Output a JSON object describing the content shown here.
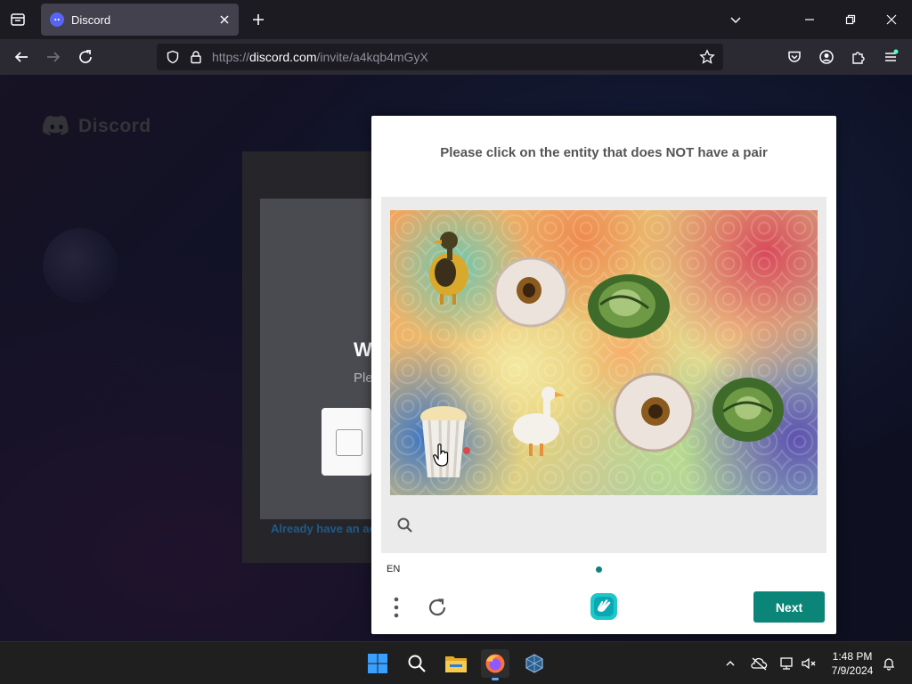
{
  "browser": {
    "tab_title": "Discord",
    "url_prefix": "https://",
    "url_host": "discord.com",
    "url_path": "/invite/a4kqb4mGyX"
  },
  "page": {
    "brand": "Discord",
    "auth_title_partial": "W",
    "auth_subtitle_partial": "Ple",
    "already_link_partial": "Already have an ac"
  },
  "captcha": {
    "prompt": "Please click on the entity that does NOT have a pair",
    "language": "EN",
    "next_label": "Next",
    "objects": [
      "duck",
      "donut",
      "cabbage",
      "popcorn",
      "goose",
      "donut",
      "cabbage"
    ]
  },
  "taskbar": {
    "time": "1:48 PM",
    "date": "7/9/2024"
  },
  "colors": {
    "accent": "#0b8577",
    "discord_brand": "#5865f2"
  }
}
